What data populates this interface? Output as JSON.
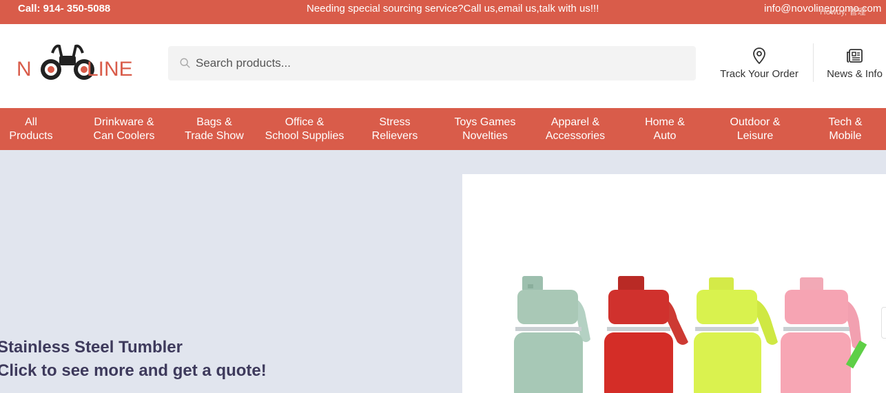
{
  "topbar": {
    "call": "Call: 914- 350-5088",
    "message": "Needing special sourcing service?Call us,email us,talk with us!!!",
    "email": "info@novolinepromo.com",
    "howdy": "Howdy, 管理"
  },
  "header": {
    "logo": {
      "left": "N",
      "middle": "OVO",
      "right": "LINE",
      "brand_color": "#d95c4a"
    },
    "search": {
      "placeholder": "Search products...",
      "value": ""
    },
    "track_order": {
      "label": "Track Your Order",
      "icon": "location-pin-icon"
    },
    "news": {
      "label": "News & Info",
      "icon": "newspaper-icon"
    }
  },
  "nav": {
    "items": [
      {
        "line1": "All",
        "line2": "Products"
      },
      {
        "line1": "Drinkware &",
        "line2": "Can Coolers"
      },
      {
        "line1": "Bags &",
        "line2": "Trade Show"
      },
      {
        "line1": "Office &",
        "line2": "School Supplies"
      },
      {
        "line1": "Stress",
        "line2": "Relievers"
      },
      {
        "line1": "Toys Games",
        "line2": "Novelties"
      },
      {
        "line1": "Apparel &",
        "line2": "Accessories"
      },
      {
        "line1": "Home &",
        "line2": "Auto"
      },
      {
        "line1": "Outdoor &",
        "line2": "Leisure"
      },
      {
        "line1": "Tech &",
        "line2": "Mobile"
      }
    ]
  },
  "hero": {
    "line1": "Stainless Steel Tumbler",
    "line2": "Click to see more and get a quote!",
    "bottle_colors": [
      "#a9c8b6",
      "#d0312d",
      "#d9f24e",
      "#f6a4b3"
    ]
  },
  "colors": {
    "accent": "#d95c4a",
    "hero_bg": "#e1e5ee",
    "text_dark": "#3e3a5c"
  }
}
